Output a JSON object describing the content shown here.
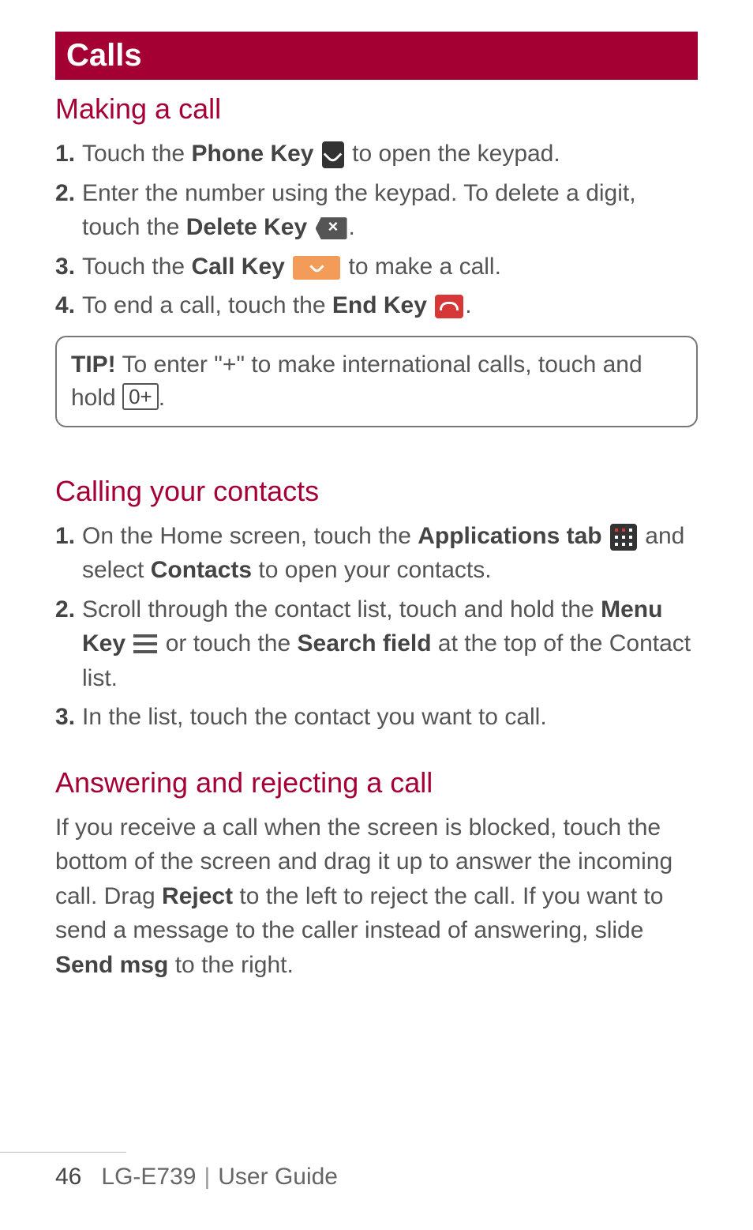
{
  "chapter_title": "Calls",
  "section1": {
    "heading": "Making a call",
    "step1_a": "Touch the ",
    "step1_b": "Phone Key",
    "step1_c": " to open the keypad.",
    "step2_a": "Enter the number using the keypad. To delete a digit, touch the ",
    "step2_b": "Delete Key",
    "step2_c": ".",
    "step3_a": "Touch the ",
    "step3_b": "Call Key",
    "step3_c": " to make a call.",
    "step4_a": "To end a call, touch the ",
    "step4_b": "End Key",
    "step4_c": "."
  },
  "tip": {
    "label": "TIP!",
    "text_a": " To enter \"+\" to make international calls, touch and hold ",
    "zero_label": "0+",
    "text_b": "."
  },
  "section2": {
    "heading": "Calling your contacts",
    "step1_a": "On the Home screen, touch the ",
    "step1_b": "Applications tab",
    "step1_c": " and select ",
    "step1_d": "Contacts",
    "step1_e": " to open your contacts.",
    "step2_a": "Scroll through the contact list, touch and hold the ",
    "step2_b": "Menu Key",
    "step2_c": " or touch the ",
    "step2_d": "Search field",
    "step2_e": " at the top of the Contact list.",
    "step3": "In the list, touch the contact you want to call."
  },
  "section3": {
    "heading": "Answering and rejecting a call",
    "para_a": "If you receive a call when the screen is blocked, touch the bottom of the screen and drag it up to answer the incoming call. Drag ",
    "para_b": "Reject",
    "para_c": " to the left to reject the call. If you want to send a message to the caller instead of answering, slide ",
    "para_d": "Send msg",
    "para_e": " to the right."
  },
  "footer": {
    "page_number": "46",
    "model": "LG-E739",
    "guide_label": "User Guide"
  },
  "icons": {
    "phone": "phone-key-icon",
    "delete": "delete-key-icon",
    "call": "call-key-icon",
    "end": "end-key-icon",
    "apps": "applications-tab-icon",
    "menu": "menu-key-icon"
  }
}
